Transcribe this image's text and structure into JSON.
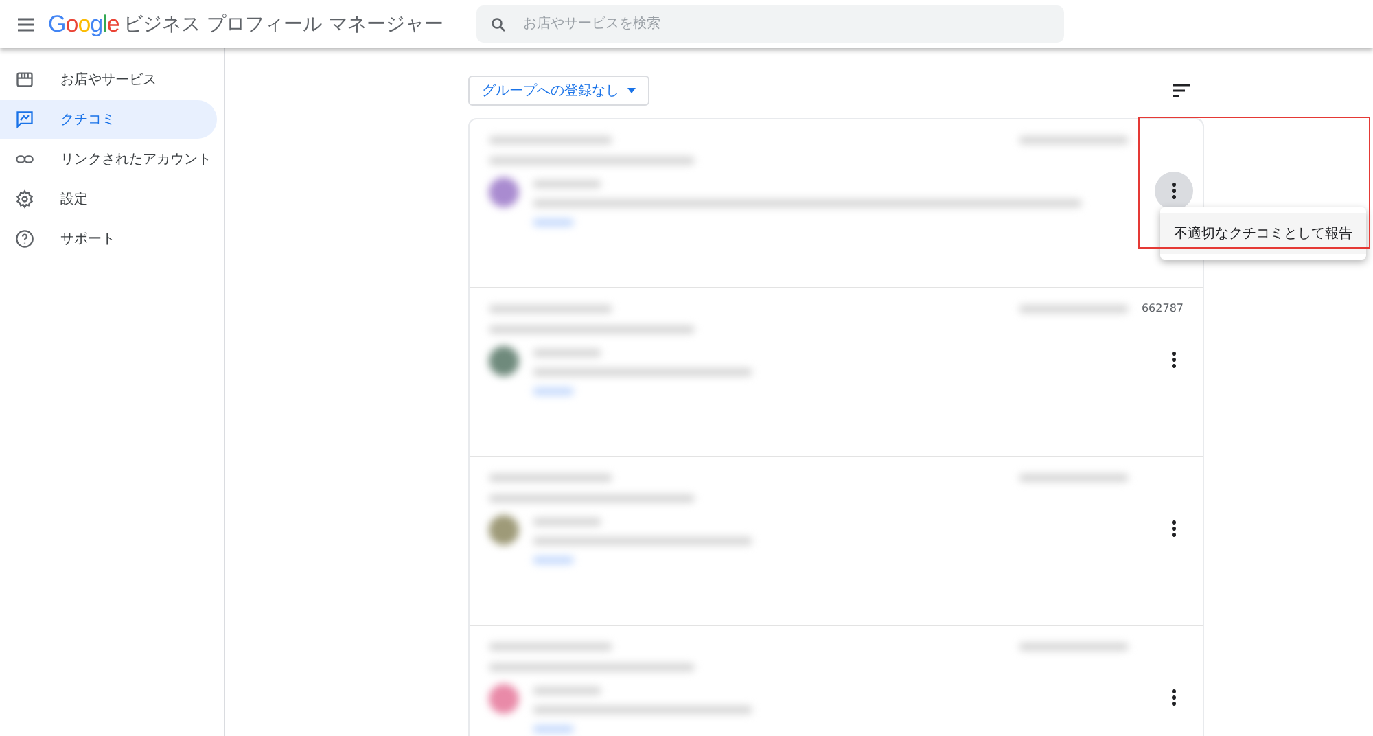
{
  "header": {
    "logo": "Google",
    "title": "ビジネス プロフィール マネージャー",
    "search": {
      "placeholder": "お店やサービスを検索"
    }
  },
  "sidebar": {
    "items": [
      {
        "label": "お店やサービス",
        "selected": false
      },
      {
        "label": "クチコミ",
        "selected": true
      },
      {
        "label": "リンクされたアカウント",
        "selected": false
      },
      {
        "label": "設定",
        "selected": false
      },
      {
        "label": "サポート",
        "selected": false
      }
    ]
  },
  "filter": {
    "label": "グループへの登録なし"
  },
  "reviews": [
    {
      "color": "#a98bd0",
      "menu_open": true
    },
    {
      "color": "#6f8a7c",
      "menu_open": false,
      "side_text": "662787"
    },
    {
      "color": "#9e9a78",
      "menu_open": false
    },
    {
      "color": "#e98aa8",
      "menu_open": false
    }
  ],
  "menu": {
    "items": [
      "不適切なクチコミとして報告"
    ]
  }
}
